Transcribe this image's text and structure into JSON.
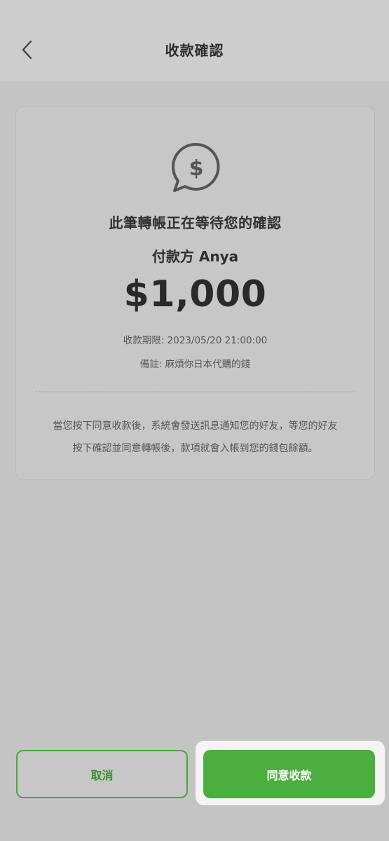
{
  "header": {
    "title": "收款確認",
    "back_icon": "chevron-left-icon"
  },
  "card": {
    "icon": "dollar-chat-bubble-icon",
    "title": "此筆轉帳正在等待您的確認",
    "payer": "付款方 Anya",
    "amount": "$1,000",
    "deadline": "收款期限:  2023/05/20 21:00:00",
    "memo": "備註: 麻煩你日本代購的錢",
    "notice_line1": "當您按下同意收款後，系統會發送訊息通知您的好友，等您的好友",
    "notice_line2": "按下確認並同意轉帳後，款項就會入帳到您的錢包餘額。"
  },
  "actions": {
    "cancel_label": "取消",
    "agree_label": "同意收款"
  },
  "colors": {
    "accent": "#4bae3e",
    "background": "#c4c4c4",
    "header": "#cdcdcd"
  }
}
